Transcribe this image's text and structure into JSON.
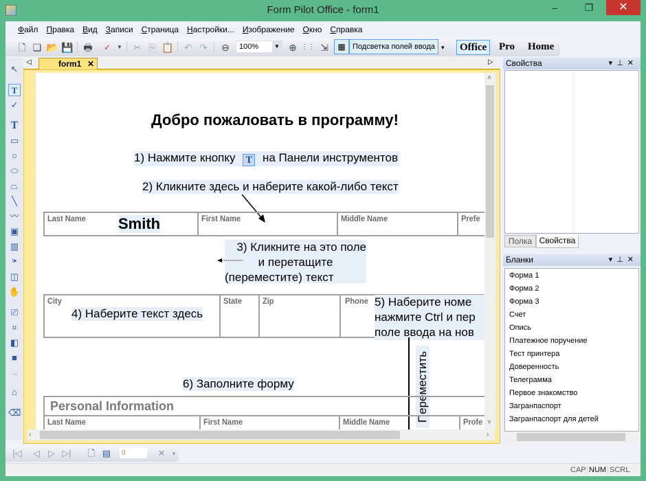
{
  "window": {
    "title": "Form Pilot Office - form1",
    "controls": [
      "–",
      "❐",
      "✕"
    ]
  },
  "menu": [
    "Файл",
    "Правка",
    "Вид",
    "Записи",
    "Страница",
    "Настройки...",
    "Изображение",
    "Окно",
    "Справка"
  ],
  "toolbar": {
    "zoom_value": "100%",
    "highlight_label": "Подсветка полей ввода",
    "editions": [
      "Office",
      "Pro",
      "Home"
    ],
    "active_edition": "Office"
  },
  "document": {
    "tab_label": "form1",
    "heading": "Добро пожаловать в программу!",
    "step1_before": "1) Нажмите кнопку",
    "step1_after": "на Панели инструментов",
    "step2": "2) Кликните здесь и наберите какой-либо текст",
    "row1_labels": [
      "Last Name",
      "First Name",
      "Middle Name",
      "Prefe"
    ],
    "last_name_value": "Smith",
    "step3": [
      "3) Кликните на это поле",
      "и перетащите",
      "(переместите) текст"
    ],
    "row2_labels": [
      "City",
      "State",
      "Zip",
      "Phone"
    ],
    "step4": "4) Наберите текст здесь",
    "step5": [
      "5) Наберите номе",
      "нажмите Ctrl и пер",
      "поле ввода на нов"
    ],
    "vertical_text": "Переместить",
    "step6": "6) Заполните форму",
    "section_title": "Personal Information",
    "row3_labels": [
      "Last Name",
      "First Name",
      "Middle Name",
      "Profe"
    ]
  },
  "properties_panel": {
    "title": "Свойства",
    "tabs": [
      "Полка",
      "Свойства"
    ],
    "active_tab": "Свойства"
  },
  "forms_panel": {
    "title": "Бланки",
    "items": [
      "Форма 1",
      "Форма 2",
      "Форма 3",
      "Счет",
      "Опись",
      "Платежное поручение",
      "Тест принтера",
      "Доверенность",
      "Телеграмма",
      "Первое знакомство",
      "Загранпаспорт",
      "Загранпаспорт для детей"
    ]
  },
  "navigation": {
    "page_number": "0"
  },
  "status": [
    "CAP",
    "NUM",
    "SCRL"
  ],
  "colors": {
    "frame": "#5bb98a",
    "close": "#c7372f",
    "tab": "#fde27e",
    "field_highlight": "#e6f0fa",
    "accent": "#5aa0e8"
  }
}
